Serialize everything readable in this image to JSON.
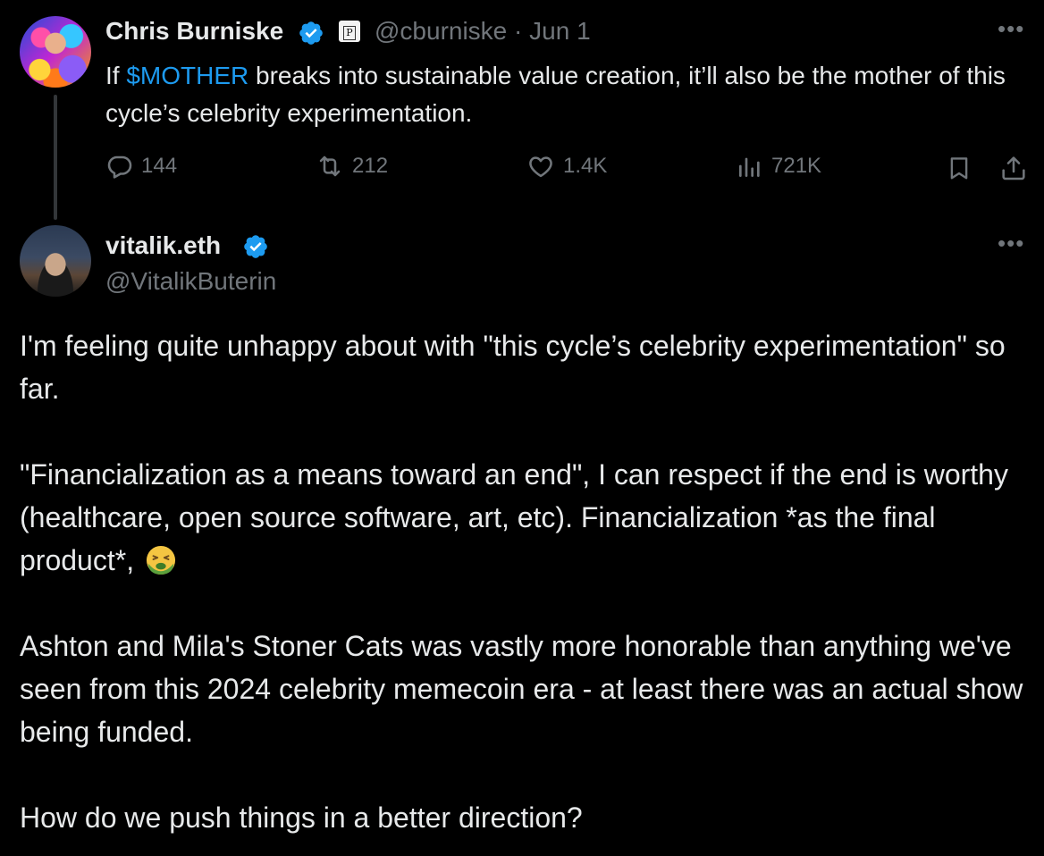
{
  "parent_tweet": {
    "author_name": "Chris Burniske",
    "affiliate_badge": "P",
    "handle": "@cburniske",
    "separator": "·",
    "date": "Jun 1",
    "text_prefix": "If ",
    "cashtag": "$MOTHER",
    "text_suffix": " breaks into sustainable value creation, it’ll also be the mother of this cycle’s celebrity experimentation.",
    "actions": {
      "replies": "144",
      "reposts": "212",
      "likes": "1.4K",
      "views": "721K"
    },
    "more_icon": "•••",
    "colors": {
      "link": "#1d9bf0",
      "verified": "#1d9bf0",
      "muted": "#71767b"
    }
  },
  "main_tweet": {
    "author_name": "vitalik.eth",
    "handle": "@VitalikButerin",
    "more_icon": "•••",
    "paragraphs": [
      "I'm feeling quite unhappy about with \"this cycle’s celebrity experimentation\" so far.",
      "\"Financialization as a means toward an end\", I can respect if the end is worthy (healthcare, open source software, art, etc). Financialization *as the final product*,",
      "Ashton and Mila's Stoner Cats was vastly more honorable than anything we've seen from this 2024 celebrity memecoin era - at least there was an actual show being funded.",
      "How do we push things in a better direction?"
    ],
    "emoji": "nauseated-face-icon"
  }
}
